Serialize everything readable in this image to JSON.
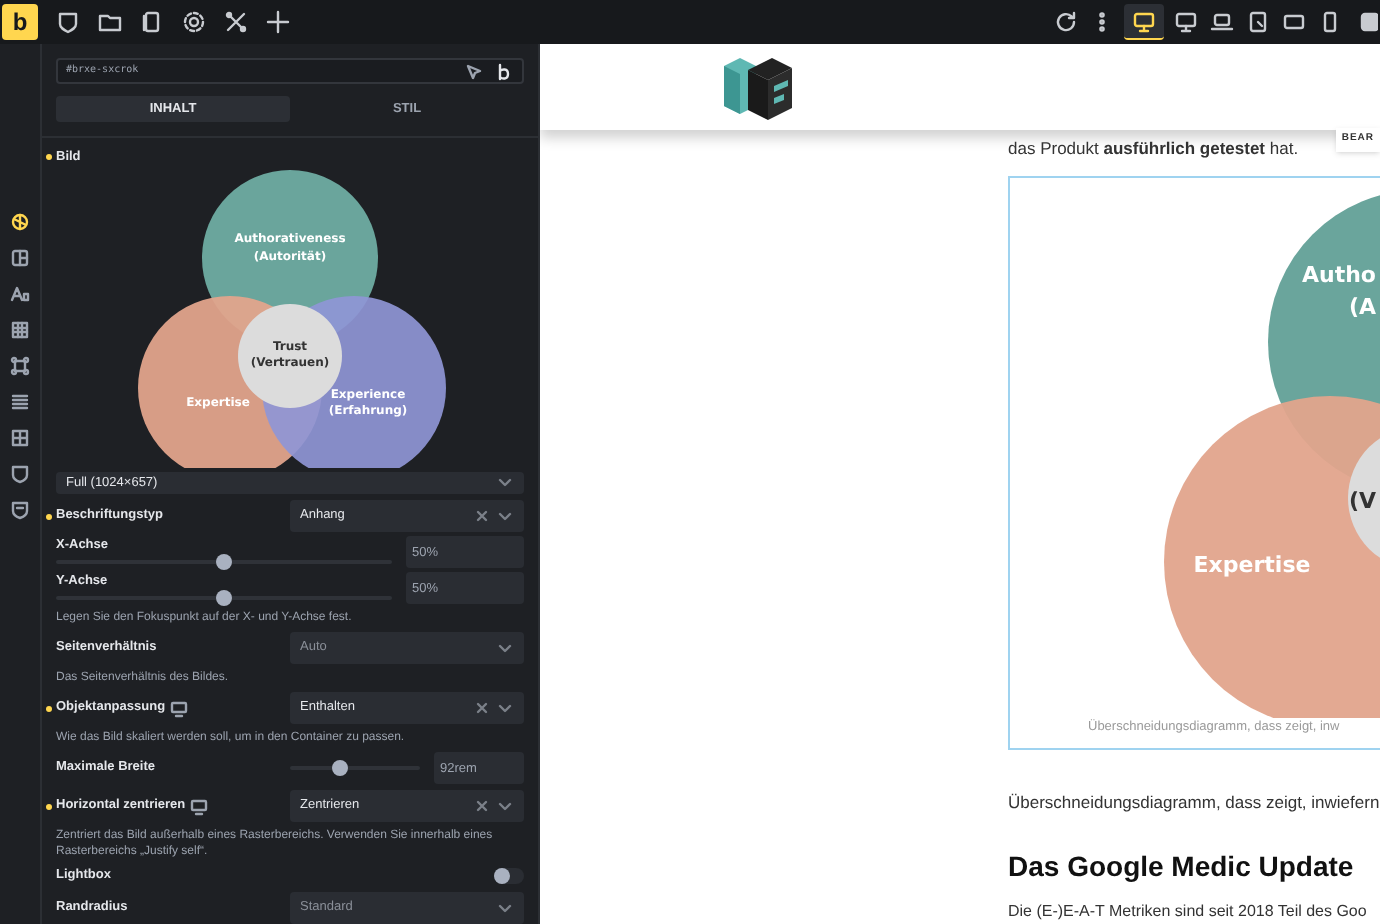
{
  "top_toolbar": {
    "logo": "b",
    "tools": [
      {
        "kind": "shield"
      },
      {
        "kind": "folder"
      },
      {
        "kind": "pages"
      },
      {
        "kind": "gear"
      },
      {
        "kind": "cross"
      },
      {
        "kind": "plus"
      }
    ]
  },
  "viewport_toolbar": {
    "devices": [
      {
        "kind": "refresh",
        "selected": false
      },
      {
        "kind": "dots",
        "selected": false
      },
      {
        "kind": "desktop",
        "selected": true
      },
      {
        "kind": "monitor",
        "selected": false
      },
      {
        "kind": "laptop",
        "selected": false
      },
      {
        "kind": "tablet",
        "selected": false
      },
      {
        "kind": "landscape",
        "selected": false
      },
      {
        "kind": "phone",
        "selected": false
      },
      {
        "kind": "edge",
        "selected": false
      }
    ]
  },
  "sidebar": {
    "items": [
      {
        "selected": true
      },
      {
        "selected": false
      },
      {
        "selected": false
      },
      {
        "selected": false
      },
      {
        "selected": false
      },
      {
        "selected": false
      },
      {
        "selected": false
      },
      {
        "selected": false
      },
      {
        "selected": false
      }
    ]
  },
  "panel": {
    "id_field": {
      "value": "#brxe-sxcrok"
    },
    "tabs": [
      {
        "label": "INHALT",
        "selected": true
      },
      {
        "label": "STIL",
        "selected": false
      }
    ],
    "section": {
      "label": "Bild",
      "modified": true
    },
    "image": {
      "labels": [
        "Authorativeness",
        "(Autorität)",
        "Trust",
        "(Vertrauen)",
        "Expertise",
        "Experience",
        "(Erfahrung)"
      ]
    },
    "size_select": {
      "value": "Full (1024×657)"
    },
    "fields": [
      {
        "kind": "select",
        "label": "Beschriftungstyp",
        "modified": true,
        "responsive": false,
        "value": "Anhang",
        "clearable": true
      },
      {
        "kind": "slider",
        "label": "X-Achse",
        "level": 0.5,
        "value": "50%"
      },
      {
        "kind": "slider",
        "label": "Y-Achse",
        "level": 0.5,
        "value": "50%"
      },
      {
        "kind": "help",
        "text": "Legen Sie den Fokuspunkt auf der X- und Y-Achse fest."
      },
      {
        "kind": "select",
        "label": "Seitenverhältnis",
        "modified": false,
        "responsive": false,
        "placeholder": "Auto",
        "clearable": false
      },
      {
        "kind": "help",
        "text": "Das Seitenverhältnis des Bildes."
      },
      {
        "kind": "select",
        "label": "Objektanpassung",
        "modified": true,
        "responsive": true,
        "value": "Enthalten",
        "clearable": true
      },
      {
        "kind": "help",
        "text": "Wie das Bild skaliert werden soll, um in den Container zu passen."
      },
      {
        "kind": "range",
        "label": "Maximale Breite",
        "level": 0.38,
        "value": "92rem"
      },
      {
        "kind": "select",
        "label": "Horizontal zentrieren",
        "modified": true,
        "responsive": true,
        "value": "Zentrieren",
        "clearable": true
      },
      {
        "kind": "help",
        "text": "Zentriert das Bild außerhalb eines Rasterbereichs. Verwenden Sie innerhalb eines Rasterbereichs „Justify self“."
      },
      {
        "kind": "toggle",
        "label": "Lightbox",
        "on": false
      },
      {
        "kind": "select",
        "label": "Randradius",
        "modified": false,
        "responsive": false,
        "placeholder": "Standard",
        "clearable": false
      }
    ]
  },
  "canvas": {
    "badge": "BEAR",
    "intro": "das Produkt **ausführlich getestet** hat.",
    "figure": {
      "labels": [
        "Autho",
        "(A",
        "(V",
        "Expertise"
      ],
      "caption": "Überschneidungsdiagramm, dass zeigt, inw"
    },
    "paragraph": "Überschneidungsdiagramm, dass zeigt, inwiefern",
    "heading": "Das Google Medic Update",
    "body": "Die (E-)E-A-T Metriken sind seit 2018 Teil des Goo"
  }
}
